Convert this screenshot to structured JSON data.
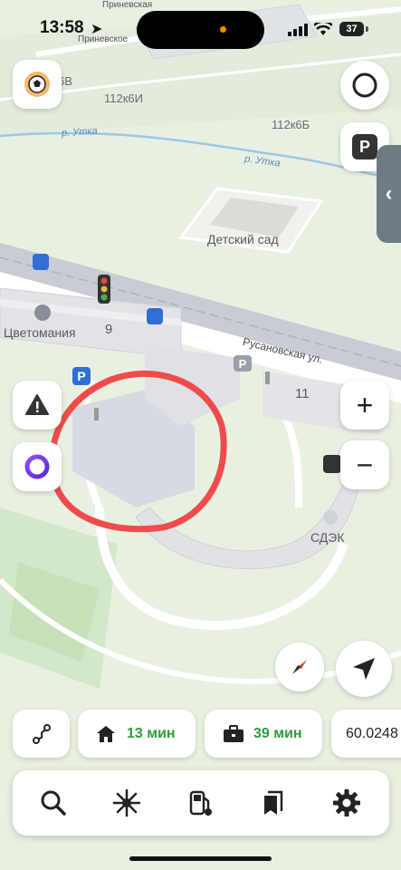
{
  "status_bar": {
    "time": "13:58",
    "battery": "37",
    "top_street": "Приневская",
    "top_street_2": "Приневское"
  },
  "map": {
    "labels": {
      "building_top": "6В",
      "building_112k6i": "112к6И",
      "building_112k6b": "112к6Б",
      "river_1": "р. Утка",
      "river_2": "р. Утка",
      "kindergarten": "Детский сад",
      "shop": "Цветомания",
      "house_9": "9",
      "street": "Русановская ул.",
      "house_11": "11",
      "cdek": "СДЭК"
    },
    "colors": {
      "park": "#d3e8c9",
      "road": "#ffffff",
      "building": "#dcdde0",
      "water": "#9fc6e8",
      "annotation": "#ef4b4b",
      "railway": "#b9bcc6"
    }
  },
  "buttons": {
    "top_left_icon": "soccer-ball-icon",
    "alice_icon": "alice-icon",
    "warning_icon": "warning-icon",
    "parking_label": "P",
    "zoom_in": "+",
    "zoom_out": "−"
  },
  "chips": {
    "home_time": "13 мин",
    "work_time": "39 мин",
    "coordinate": "60.0248"
  },
  "toolbar": {
    "items": [
      "search-icon",
      "compass-spark-icon",
      "gas-station-icon",
      "bookmarks-icon",
      "settings-icon"
    ]
  }
}
